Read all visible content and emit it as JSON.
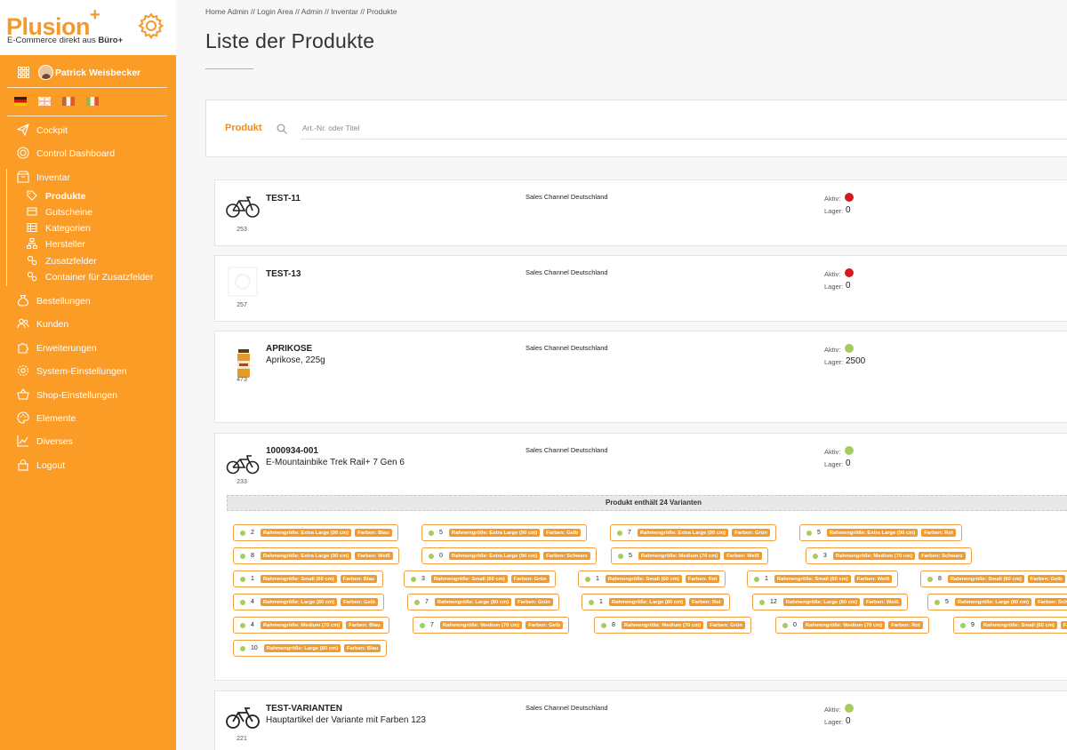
{
  "brand": {
    "logo": "Plusion",
    "logo_plus": "+",
    "tagline": "E-Commerce direkt aus",
    "tagline_bold": "Büro+"
  },
  "colors": {
    "accent": "#fb9c27",
    "active_dot": "#a5cc5c",
    "inactive_dot": "#d41a1a"
  },
  "user": {
    "name": "Patrick Weisbecker"
  },
  "nav": {
    "cockpit": "Cockpit",
    "control_dashboard": "Control Dashboard",
    "inventar": "Inventar",
    "produkte": "Produkte",
    "gutscheine": "Gutscheine",
    "kategorien": "Kategorien",
    "hersteller": "Hersteller",
    "zusatzfelder": "Zusatzfelder",
    "container": "Container für Zusatzfelder",
    "bestellungen": "Bestellungen",
    "kunden": "Kunden",
    "erweiterungen": "Erweiterungen",
    "system": "System-Einstellungen",
    "shop": "Shop-Einstellungen",
    "elemente": "Elemente",
    "diverses": "Diverses",
    "logout": "Logout"
  },
  "breadcrumb": "Home Admin // Login Area // Admin // Inventar // Produkte",
  "page_title": "Liste der Produkte",
  "search": {
    "label": "Produkt",
    "placeholder": "Art.-Nr. oder Titel",
    "value": ""
  },
  "labels": {
    "aktiv": "Aktiv:",
    "lager": "Lager:"
  },
  "products": [
    {
      "sku": "TEST-11",
      "title": "",
      "id": "253",
      "channel": "Sales Channel Deutschland",
      "active": false,
      "stock": "0"
    },
    {
      "sku": "TEST-13",
      "title": "",
      "id": "257",
      "channel": "Sales Channel Deutschland",
      "active": false,
      "stock": "0"
    },
    {
      "sku": "APRIKOSE",
      "title": "Aprikose, 225g",
      "id": "473",
      "channel": "Sales Channel Deutschland",
      "active": true,
      "stock": "2500"
    },
    {
      "sku": "1000934-001",
      "title": "E-Mountainbike Trek Rail+ 7 Gen 6",
      "id": "233",
      "channel": "Sales Channel Deutschland",
      "active": true,
      "stock": "0"
    },
    {
      "sku": "TEST-VARIANTEN",
      "title": "Hauptartikel der Variante mit Farben 123",
      "id": "221",
      "channel": "Sales Channel Deutschland",
      "active": true,
      "stock": "0"
    }
  ],
  "variants_notice": "Produkt enthält 24 Varianten",
  "variants": [
    {
      "qty": "2",
      "size": "Rahmengröße: Extra Large (90 cm)",
      "color": "Farben: Blau"
    },
    {
      "qty": "5",
      "size": "Rahmengröße: Extra Large (90 cm)",
      "color": "Farben: Gelb"
    },
    {
      "qty": "7",
      "size": "Rahmengröße: Extra Large (90 cm)",
      "color": "Farben: Grün"
    },
    {
      "qty": "5",
      "size": "Rahmengröße: Extra Large (90 cm)",
      "color": "Farben: Rot"
    },
    {
      "qty": "8",
      "size": "Rahmengröße: Extra Large (90 cm)",
      "color": "Farben: Weiß"
    },
    {
      "qty": "0",
      "size": "Rahmengröße: Extra Large (90 cm)",
      "color": "Farben: Schwarz"
    },
    {
      "qty": "5",
      "size": "Rahmengröße: Medium (70 cm)",
      "color": "Farben: Weiß"
    },
    {
      "qty": "3",
      "size": "Rahmengröße: Medium (70 cm)",
      "color": "Farben: Schwarz"
    },
    {
      "qty": "1",
      "size": "Rahmengröße: Small (60 cm)",
      "color": "Farben: Blau"
    },
    {
      "qty": "3",
      "size": "Rahmengröße: Small (60 cm)",
      "color": "Farben: Grün"
    },
    {
      "qty": "1",
      "size": "Rahmengröße: Small (60 cm)",
      "color": "Farben: Rot"
    },
    {
      "qty": "1",
      "size": "Rahmengröße: Small (60 cm)",
      "color": "Farben: Weiß"
    },
    {
      "qty": "8",
      "size": "Rahmengröße: Small (60 cm)",
      "color": "Farben: Gelb"
    },
    {
      "qty": "4",
      "size": "Rahmengröße: Large (80 cm)",
      "color": "Farben: Gelb"
    },
    {
      "qty": "7",
      "size": "Rahmengröße: Large (80 cm)",
      "color": "Farben: Grün"
    },
    {
      "qty": "1",
      "size": "Rahmengröße: Large (80 cm)",
      "color": "Farben: Rot"
    },
    {
      "qty": "12",
      "size": "Rahmengröße: Large (80 cm)",
      "color": "Farben: Weiß"
    },
    {
      "qty": "5",
      "size": "Rahmengröße: Large (80 cm)",
      "color": "Farben: Schwarz"
    },
    {
      "qty": "4",
      "size": "Rahmengröße: Medium (70 cm)",
      "color": "Farben: Blau"
    },
    {
      "qty": "7",
      "size": "Rahmengröße: Medium (70 cm)",
      "color": "Farben: Gelb"
    },
    {
      "qty": "8",
      "size": "Rahmengröße: Medium (70 cm)",
      "color": "Farben: Grün"
    },
    {
      "qty": "0",
      "size": "Rahmengröße: Medium (70 cm)",
      "color": "Farben: Rot"
    },
    {
      "qty": "9",
      "size": "Rahmengröße: Small (60 cm)",
      "color": "Farben: Schwarz"
    },
    {
      "qty": "10",
      "size": "Rahmengröße: Large (80 cm)",
      "color": "Farben: Blau"
    }
  ]
}
